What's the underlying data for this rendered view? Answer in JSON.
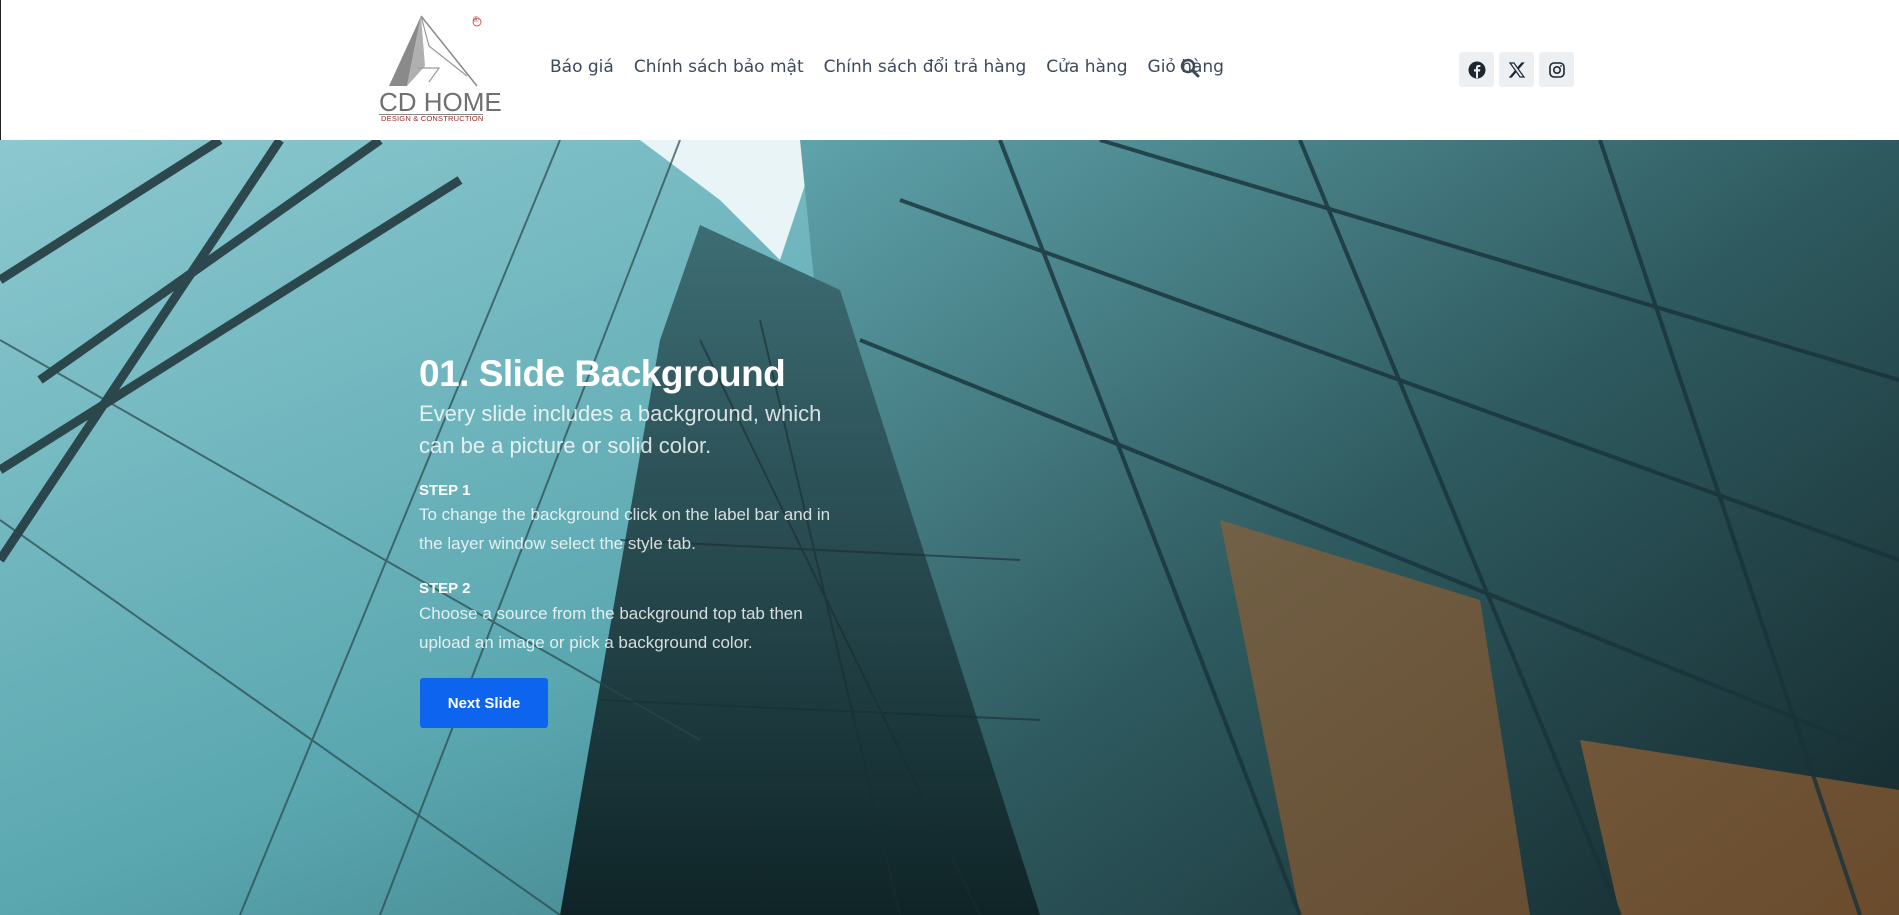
{
  "logo": {
    "name": "CD HOME",
    "tagline": "DESIGN & CONSTRUCTION",
    "registered": "®"
  },
  "nav": {
    "items": [
      {
        "label": "Báo giá"
      },
      {
        "label": "Chính sách bảo mật"
      },
      {
        "label": "Chính sách đổi trả hàng"
      },
      {
        "label": "Cửa hàng"
      },
      {
        "label": "Giỏ hàng"
      }
    ],
    "search_icon": "search-icon"
  },
  "socials": [
    {
      "icon": "facebook-icon"
    },
    {
      "icon": "x-twitter-icon"
    },
    {
      "icon": "instagram-icon"
    }
  ],
  "hero": {
    "title": "01. Slide Background",
    "subtitle": "Every slide includes a background, which can be a picture or solid color.",
    "step1_label": "STEP 1",
    "step1_text": "To change the background click on the label bar and in the layer window select the style tab.",
    "step2_label": "STEP 2",
    "step2_text": "Choose a source from the background top tab then upload an image or pick a background color.",
    "button_label": "Next Slide"
  },
  "colors": {
    "nav_text": "#3d4a5c",
    "button_bg": "#0d64ee",
    "social_bg": "#edf0f3"
  }
}
